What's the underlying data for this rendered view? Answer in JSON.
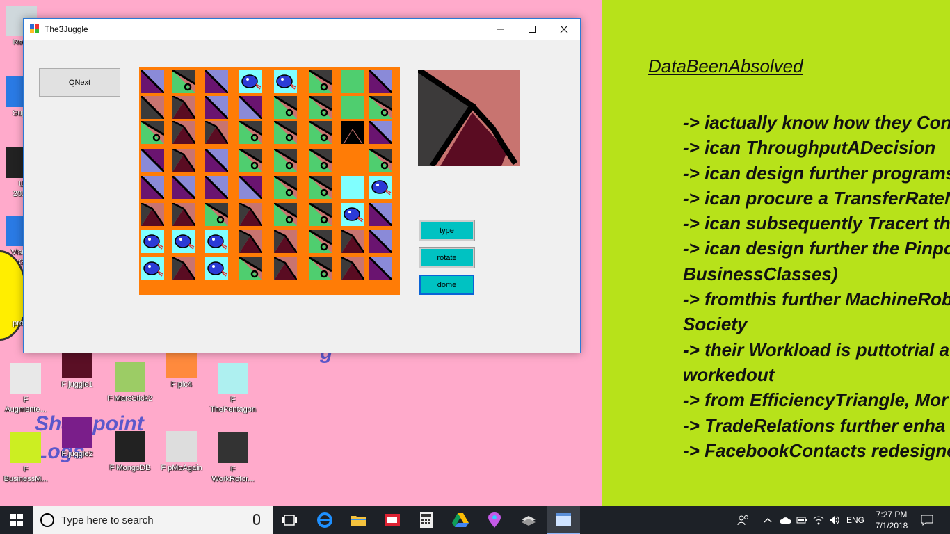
{
  "window": {
    "title": "The3Juggle",
    "buttons": {
      "qnext": "QNext",
      "type": "type",
      "rotate": "rotate",
      "dome": "dome"
    },
    "board": {
      "rows": [
        [
          "tri-pv",
          "tri-gd",
          "tri-pv",
          "blob",
          "blob",
          "tri-gd",
          "solid-green",
          "tri-pv"
        ],
        [
          "tri-pr",
          "tri-dr",
          "tri-pv",
          "tri-vp",
          "tri-gd",
          "tri-gd",
          "solid-green",
          "tri-gd"
        ],
        [
          "tri-gd",
          "tri-dr",
          "tri-dr",
          "tri-gd",
          "tri-gd",
          "tri-gd",
          "notch-black",
          "tri-pv"
        ],
        [
          "tri-vp",
          "tri-dr",
          "tri-pv",
          "tri-gd",
          "tri-gd",
          "tri-gd",
          "empty",
          "tri-gd"
        ],
        [
          "tri-pv",
          "tri-pv",
          "tri-pv",
          "tri-vp",
          "tri-gd",
          "tri-gd",
          "cyan",
          "blob"
        ],
        [
          "tri-dr",
          "tri-dr",
          "tri-gd",
          "tri-dr",
          "tri-gd",
          "tri-gd",
          "blob",
          "tri-pv"
        ],
        [
          "blob",
          "blob",
          "blob",
          "tri-dr",
          "tri-dr",
          "tri-gd",
          "tri-dr",
          "tri-pv"
        ],
        [
          "blob",
          "tri-dr",
          "blob",
          "tri-gd",
          "tri-dr",
          "tri-gd",
          "tri-dr",
          "tri-pv"
        ]
      ]
    }
  },
  "desktop": {
    "right_title": "DataBeenAbsolved",
    "right_lines": [
      "-> iactually know how they Con",
      "-> ican ThroughputADecision",
      "-> ican design further programs",
      "-> ican procure a TransferRateN",
      "-> ican subsequently Tracert the",
      "-> ican design further the Pinpo",
      "BusinessClasses)",
      "-> fromthis further MachineRob",
      "Society",
      "-> their Workload is puttotrial a",
      "workedout",
      "-> from EfficiencyTriangle, Mor",
      "-> TradeRelations further enha",
      "-> FacebookContacts redesigne"
    ],
    "icons": [
      {
        "label": "Recy",
        "color": "#cfd8dc"
      },
      {
        "label": "Supp",
        "color": "#2a7ae4"
      },
      {
        "label": "U\n2017",
        "color": "#222222"
      },
      {
        "label": "Visual\nG",
        "color": "#2a7ae4"
      },
      {
        "label": "pro-e",
        "color": "#ffee00"
      },
      {
        "label": "F\nAugmente...",
        "color": "#e8e8e8"
      },
      {
        "label": "F juggle1",
        "color": "#5a0f25"
      },
      {
        "label": "F MarsStick2",
        "color": "#9ccc65"
      },
      {
        "label": "F pic4",
        "color": "#ff8a3d"
      },
      {
        "label": "F\nThePentagon",
        "color": "#aef0f0"
      },
      {
        "label": "F\nBusinessM...",
        "color": "#ccee22"
      },
      {
        "label": "F juggle2",
        "color": "#7a1e8a"
      },
      {
        "label": "F MongoDB",
        "color": "#222222"
      },
      {
        "label": "F pMoAgain",
        "color": "#dddddd"
      },
      {
        "label": "F\nWorkRotor...",
        "color": "#333333"
      }
    ],
    "bg_text_1": "Sharepoint",
    "bg_text_2": "Logs",
    "bg_text_3": "g"
  },
  "taskbar": {
    "search_placeholder": "Type here to search",
    "language": "ENG",
    "time": "7:27 PM",
    "date": "7/1/2018"
  },
  "colors": {
    "board_bg": "#ff7c06",
    "button_cyan": "#00c2c2",
    "lime": "#b7e21a",
    "pink": "#ffaacb"
  }
}
